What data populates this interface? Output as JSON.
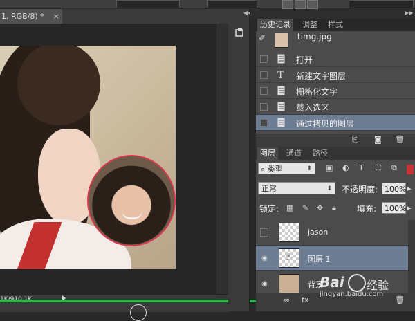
{
  "doc_tab": {
    "title": "1, RGB/8) *",
    "close": "×"
  },
  "status": {
    "doc_size": "1K/910.1K"
  },
  "history": {
    "tabs": [
      "历史记录",
      "调整",
      "样式"
    ],
    "snapshot": "timg.jpg",
    "items": [
      {
        "label": "打开",
        "icon": "document-icon"
      },
      {
        "label": "新建文字图层",
        "icon": "text-tool-icon"
      },
      {
        "label": "栅格化文字",
        "icon": "document-icon"
      },
      {
        "label": "载入选区",
        "icon": "document-icon"
      },
      {
        "label": "通过拷贝的图层",
        "icon": "document-icon"
      }
    ]
  },
  "layers": {
    "tabs": [
      "图层",
      "通道",
      "路径"
    ],
    "filter": "类型",
    "blend_mode": "正常",
    "opacity_label": "不透明度:",
    "opacity": "100%",
    "lock_label": "锁定:",
    "fill_label": "填充:",
    "fill": "100%",
    "items": [
      {
        "name": "jason",
        "visible": false,
        "selected": false
      },
      {
        "name": "图层 1",
        "visible": true,
        "selected": true
      },
      {
        "name": "背景",
        "visible": true,
        "selected": false
      }
    ]
  },
  "watermark": {
    "text": "Bai",
    "suffix": "经验",
    "url": "jingyan.baidu.com"
  },
  "colors": {
    "selection": "#6d7d94",
    "accent_green": "#29b74a",
    "panel": "#4b4b4b"
  }
}
